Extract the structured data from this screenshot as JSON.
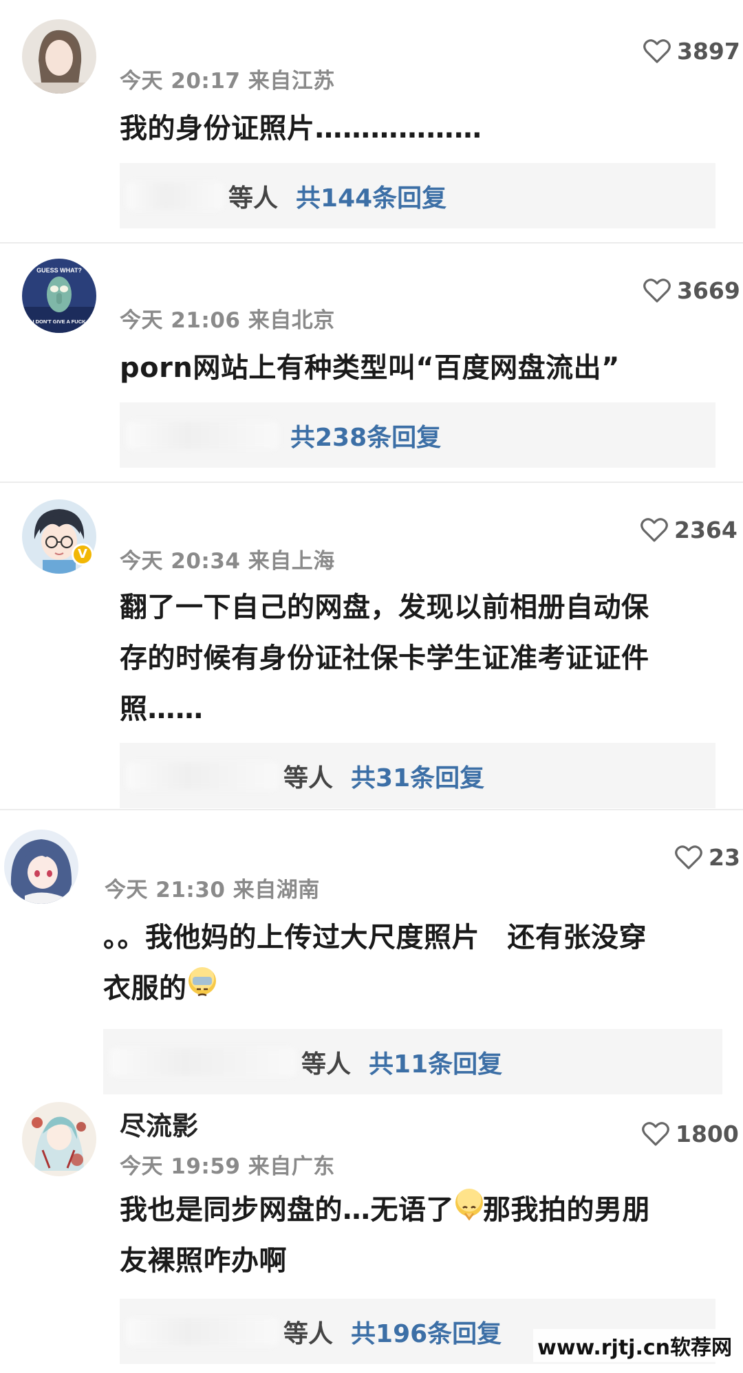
{
  "comments": [
    {
      "meta": "今天 20:17 来自江苏",
      "likes": "3897",
      "lines": [
        "我的身份证照片………………"
      ],
      "reply_who": "等人",
      "reply_count": "共144条回复"
    },
    {
      "meta": "今天 21:06 来自北京",
      "likes": "3669",
      "lines": [
        "porn网站上有种类型叫“百度网盘流出”"
      ],
      "reply_who": "",
      "reply_count": "共238条回复"
    },
    {
      "meta": "今天 20:34 来自上海",
      "likes": "2364",
      "lines": [
        "翻了一下自己的网盘，发现以前相册自动保",
        "存的时候有身份证社保卡学生证准考证证件",
        "照……"
      ],
      "reply_who": "等人",
      "reply_count": "共31条回复"
    },
    {
      "meta": "今天 21:30 来自湖南",
      "likes": "23",
      "lines": [
        "。。我他妈的上传过大尺度照片　还有张没穿",
        "衣服的"
      ],
      "reply_who": "等人",
      "reply_count": "共11条回复"
    },
    {
      "username": "尽流影",
      "meta": "今天 19:59 来自广东",
      "likes": "1800",
      "lines": [
        "我也是同步网盘的…无语了",
        "友裸照咋办啊"
      ],
      "line1_suffix": "那我拍的男朋",
      "reply_who": "等人",
      "reply_count": "共196条回复"
    }
  ],
  "avatar_text": {
    "c2_top": "GUESS WHAT?",
    "c2_bottom": "I DON'T GIVE A FUCK"
  },
  "watermark": "www.rjtj.cn软荐网",
  "colors": {
    "reply_link": "#3c6fa6",
    "meta": "#8a8a8a",
    "verified": "#f2b705"
  }
}
